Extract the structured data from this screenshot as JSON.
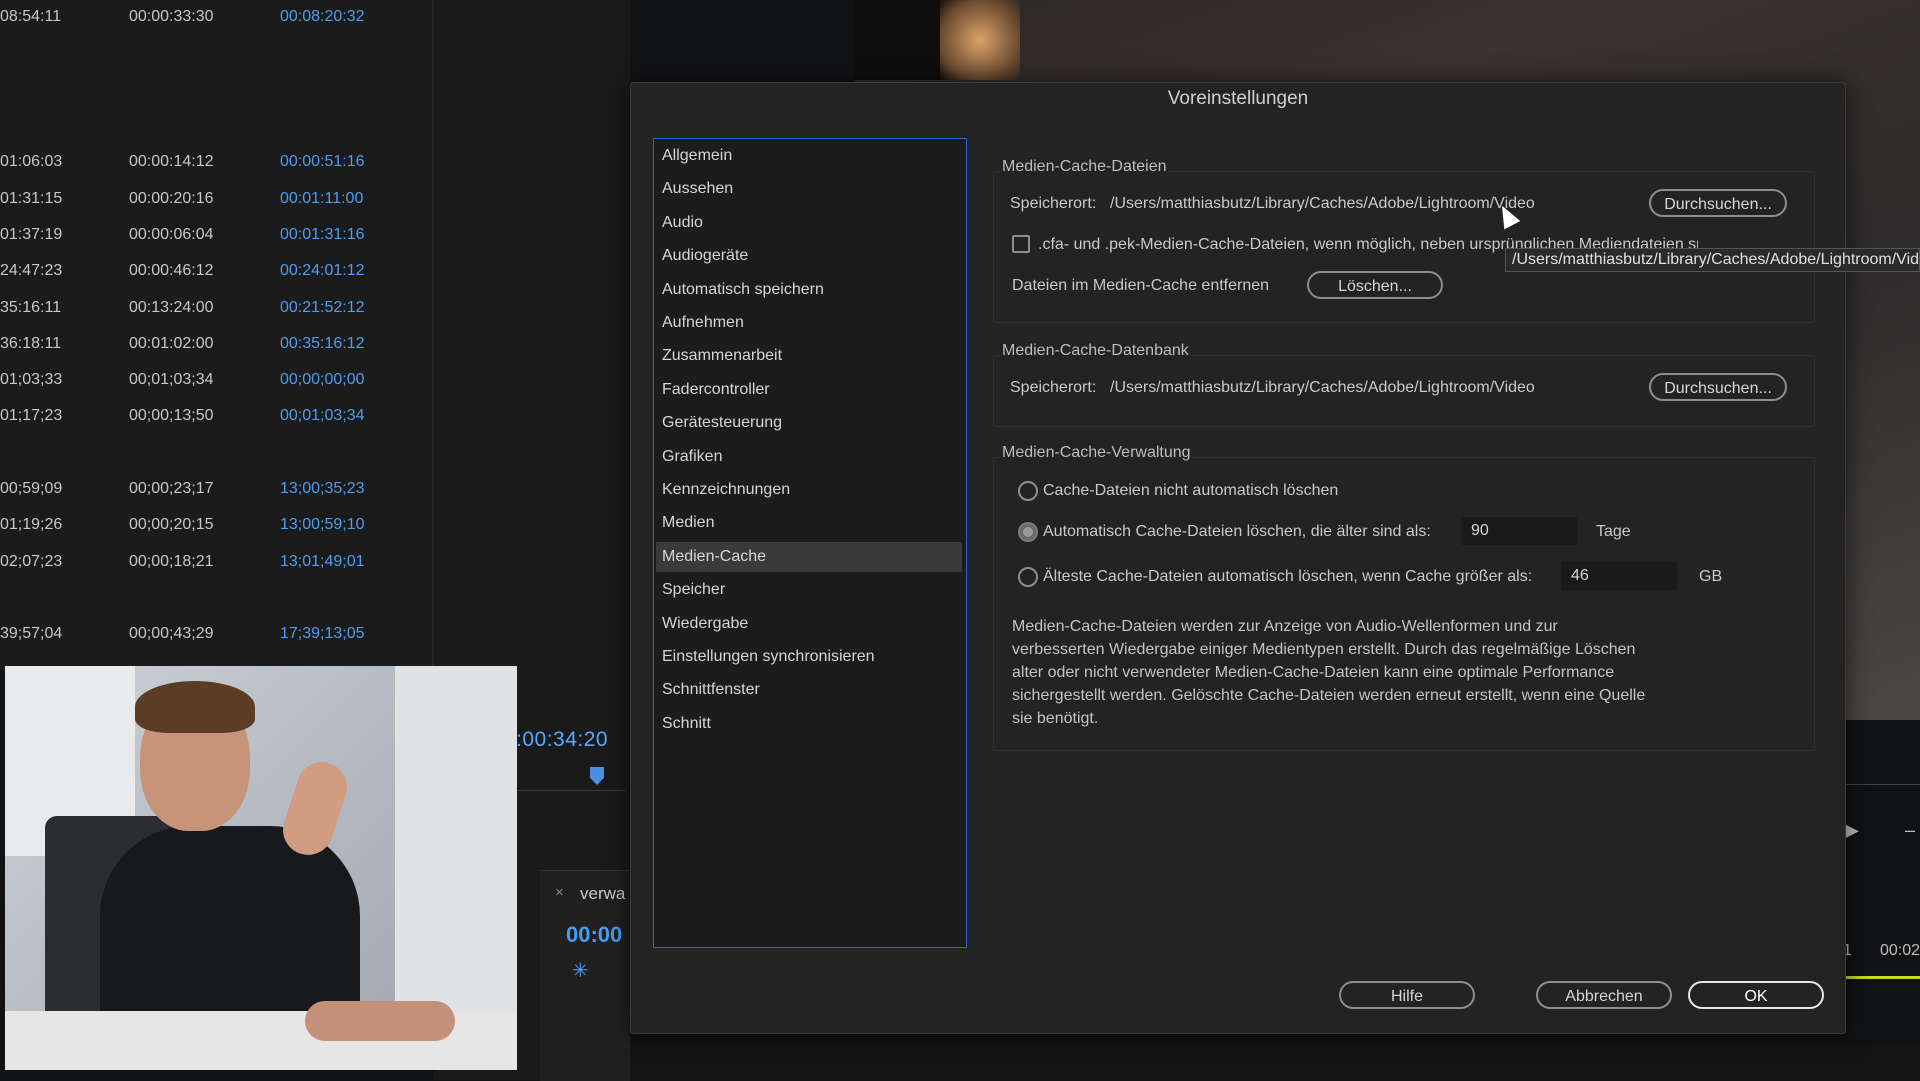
{
  "background": {
    "project_rows": [
      {
        "c1": "08:54:11",
        "c2": "00:00:33:30",
        "c3": "00:08:20:32"
      },
      {
        "c1": "01:06:03",
        "c2": "00:00:14:12",
        "c3": "00:00:51:16"
      },
      {
        "c1": "01:31:15",
        "c2": "00:00:20:16",
        "c3": "00:01:11:00"
      },
      {
        "c1": "01:37:19",
        "c2": "00:00:06:04",
        "c3": "00:01:31:16"
      },
      {
        "c1": "24:47:23",
        "c2": "00:00:46:12",
        "c3": "00:24:01:12"
      },
      {
        "c1": "35:16:11",
        "c2": "00:13:24:00",
        "c3": "00:21:52:12"
      },
      {
        "c1": "36:18:11",
        "c2": "00:01:02:00",
        "c3": "00:35:16:12"
      },
      {
        "c1": "01;03;33",
        "c2": "00;01;03;34",
        "c3": "00;00;00;00"
      },
      {
        "c1": "01;17;23",
        "c2": "00;00;13;50",
        "c3": "00;01;03;34"
      },
      {
        "c1": "00;59;09",
        "c2": "00;00;23;17",
        "c3": "13;00;35;23"
      },
      {
        "c1": "01;19;26",
        "c2": "00;00;20;15",
        "c3": "13;00;59;10"
      },
      {
        "c1": "02;07;23",
        "c2": "00;00;18;21",
        "c3": "13;01;49;01"
      },
      {
        "c1": "39;57;04",
        "c2": "00;00;43;29",
        "c3": "17;39;13;05"
      }
    ],
    "program_timecode": ":00:34:20",
    "panel_close": "×",
    "panel_title": "verwa",
    "panel_timecode": "00:00",
    "panel_icon": "snap-icon",
    "right_play_glyph": "▶",
    "right_dash_glyph": "–",
    "right_tc1": "1",
    "right_tc2": "00:02"
  },
  "dialog": {
    "title": "Voreinstellungen",
    "nav_items": [
      "Allgemein",
      "Aussehen",
      "Audio",
      "Audiogeräte",
      "Automatisch speichern",
      "Aufnehmen",
      "Zusammenarbeit",
      "Fadercontroller",
      "Gerätesteuerung",
      "Grafiken",
      "Kennzeichnungen",
      "Medien",
      "Medien-Cache",
      "Speicher",
      "Wiedergabe",
      "Einstellungen synchronisieren",
      "Schnittfenster",
      "Schnitt"
    ],
    "selected_nav": "Medien-Cache",
    "cache_files": {
      "title": "Medien-Cache-Dateien",
      "location_label": "Speicherort:",
      "location_path": "/Users/matthiasbutz/Library/Caches/Adobe/Lightroom/Video",
      "browse_label": "Durchsuchen...",
      "checkbox_label": ".cfa- und .pek-Medien-Cache-Dateien, wenn möglich, neben ursprünglichen Mediendateien speichern",
      "checkbox_checked": false,
      "remove_label": "Dateien im Medien-Cache entfernen",
      "delete_label": "Löschen..."
    },
    "cache_db": {
      "title": "Medien-Cache-Datenbank",
      "location_label": "Speicherort:",
      "location_path": "/Users/matthiasbutz/Library/Caches/Adobe/Lightroom/Video",
      "browse_label": "Durchsuchen..."
    },
    "cache_management": {
      "title": "Medien-Cache-Verwaltung",
      "option1": "Cache-Dateien nicht automatisch löschen",
      "option2": "Automatisch Cache-Dateien löschen, die älter sind als:",
      "option2_value": "90",
      "option2_unit": "Tage",
      "option3": "Älteste Cache-Dateien automatisch löschen, wenn Cache größer als:",
      "option3_value": "46",
      "option3_unit": "GB",
      "selected_option": 2,
      "description": "Medien-Cache-Dateien werden zur Anzeige von Audio-Wellenformen und zur verbesserten Wiedergabe einiger Medientypen erstellt. Durch das regelmäßige Löschen alter oder nicht verwendeter Medien-Cache-Dateien kann eine optimale Performance sichergestellt werden. Gelöschte Cache-Dateien werden erneut erstellt, wenn eine Quelle sie benötigt."
    },
    "tooltip": "/Users/matthiasbutz/Library/Caches/Adobe/Lightroom/Video",
    "help_label": "Hilfe",
    "cancel_label": "Abbrechen",
    "ok_label": "OK",
    "accent_color": "#2e63d8",
    "link_color": "#4f9cf0"
  }
}
